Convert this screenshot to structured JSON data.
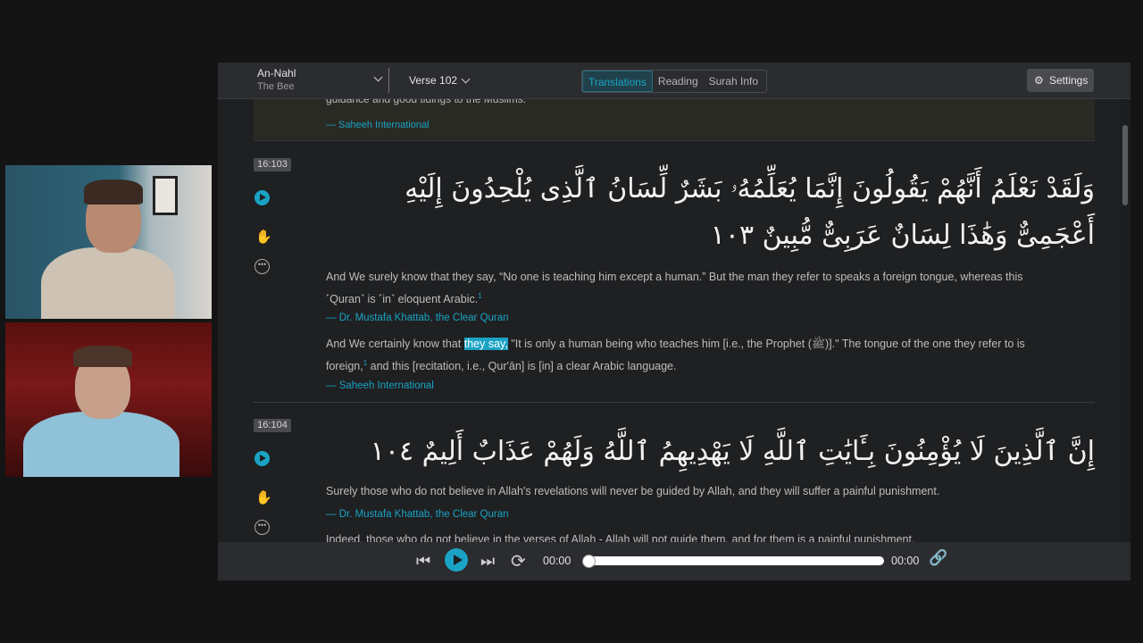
{
  "header": {
    "surah_name": "An-Nahl",
    "surah_translation": "The Bee",
    "verse_selector": "Verse 102",
    "tabs": [
      "Translations",
      "Reading",
      "Surah Info"
    ],
    "active_tab": "Translations",
    "settings_label": "Settings"
  },
  "previous": {
    "text_tail": "guidance and good tidings to the Muslims.",
    "source": "— Saheeh International"
  },
  "verses": [
    {
      "key": "16:103",
      "arabic_line1": "وَلَقَدْ نَعْلَمُ أَنَّهُمْ يَقُولُونَ إِنَّمَا يُعَلِّمُهُۥ بَشَرٌ لِّسَانُ ٱلَّذِى يُلْحِدُونَ إِلَيْهِ",
      "arabic_line2": "أَعْجَمِىٌّ وَهَٰذَا لِسَانٌ عَرَبِىٌّ مُّبِينٌ ١٠٣",
      "translation1_a": "And We surely know that they say, “No one is teaching him except a human.” But the man they refer to speaks a foreign tongue, whereas this",
      "translation1_b": "˹Quran˺ is ˹in˺ eloquent Arabic.",
      "translation1_note": "1",
      "source1": "— Dr. Mustafa Khattab, the Clear Quran",
      "translation2_pre": "And We certainly know that ",
      "translation2_hl": "they say,",
      "translation2_post": " \"It is only a human being who teaches him [i.e., the Prophet (ﷺ)].\" The tongue of the one they refer to is",
      "translation2_b1": "foreign,",
      "translation2_note": "1",
      "translation2_b2": " and this [recitation, i.e., Qur'ān] is [in] a clear Arabic language.",
      "source2": "— Saheeh International"
    },
    {
      "key": "16:104",
      "arabic_line1": "إِنَّ ٱلَّذِينَ لَا يُؤْمِنُونَ بِـَٔايَٰتِ ٱللَّهِ لَا يَهْدِيهِمُ ٱللَّهُ وَلَهُمْ عَذَابٌ أَلِيمٌ ١٠٤",
      "translation1": "Surely those who do not believe in Allah's revelations will never be guided by Allah, and they will suffer a painful punishment.",
      "source1": "— Dr. Mustafa Khattab, the Clear Quran",
      "translation2": "Indeed, those who do not believe in the verses of Allah - Allah will not guide them, and for them is a painful punishment."
    }
  ],
  "audio": {
    "current_time": "00:00",
    "total_time": "00:00",
    "progress": 0
  },
  "colors": {
    "accent": "#1aa3c4",
    "background": "#1f2022",
    "topbar": "#2b2c2f"
  },
  "icons": [
    "chevron-down-icon",
    "gear-icon",
    "play-icon",
    "hand-icon",
    "more-icon",
    "skip-back-icon",
    "skip-forward-icon",
    "repeat-icon",
    "link-icon"
  ]
}
